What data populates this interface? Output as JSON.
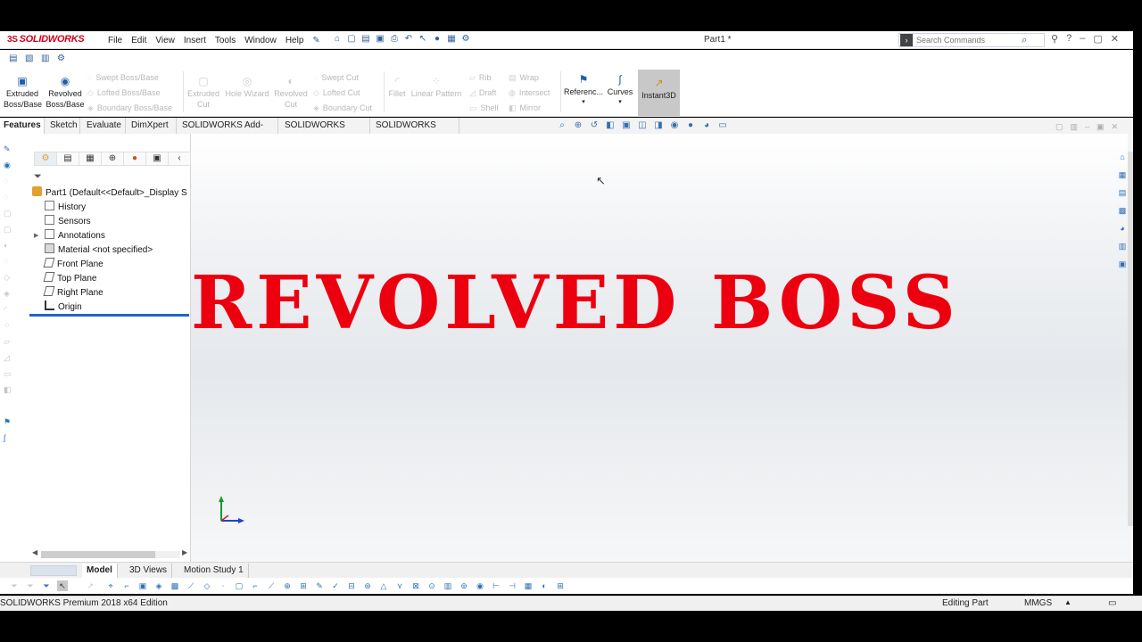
{
  "app": {
    "brand": "SOLIDWORKS",
    "menu": [
      "File",
      "Edit",
      "View",
      "Insert",
      "Tools",
      "Window",
      "Help"
    ],
    "doc_title": "Part1 *",
    "search_placeholder": "Search Commands"
  },
  "commands": {
    "extruded_boss": "Extruded Boss/Base",
    "revolved_boss": "Revolved Boss/Base",
    "swept_boss": "Swept Boss/Base",
    "lofted_boss": "Lofted Boss/Base",
    "boundary_boss": "Boundary Boss/Base",
    "extruded_cut": "Extruded Cut",
    "hole_wizard": "Hole Wizard",
    "revolved_cut": "Revolved Cut",
    "swept_cut": "Swept Cut",
    "lofted_cut": "Lofted Cut",
    "boundary_cut": "Boundary Cut",
    "fillet": "Fillet",
    "linear_pattern": "Linear Pattern",
    "rib": "Rib",
    "draft": "Draft",
    "shell": "Shell",
    "wrap": "Wrap",
    "intersect": "Intersect",
    "mirror": "Mirror",
    "reference": "Referenc...",
    "curves": "Curves",
    "instant3d": "Instant3D"
  },
  "tabs": [
    "Features",
    "Sketch",
    "Evaluate",
    "DimXpert",
    "SOLIDWORKS Add-Ins",
    "SOLIDWORKS MBD",
    "SOLIDWORKS CAM"
  ],
  "feature_tree": {
    "root": "Part1  (Default<<Default>_Display S",
    "items": [
      "History",
      "Sensors",
      "Annotations",
      "Material <not specified>",
      "Front Plane",
      "Top Plane",
      "Right Plane",
      "Origin"
    ]
  },
  "graphics": {
    "title_text": "REVOLVED BOSS"
  },
  "bottom_tabs": [
    "Model",
    "3D Views",
    "Motion Study 1"
  ],
  "status": {
    "edition": "SOLIDWORKS Premium 2018 x64 Edition",
    "mode": "Editing Part",
    "units": "MMGS"
  },
  "colors": {
    "title_red": "#ec0010",
    "accent_blue": "#1f64c4"
  }
}
